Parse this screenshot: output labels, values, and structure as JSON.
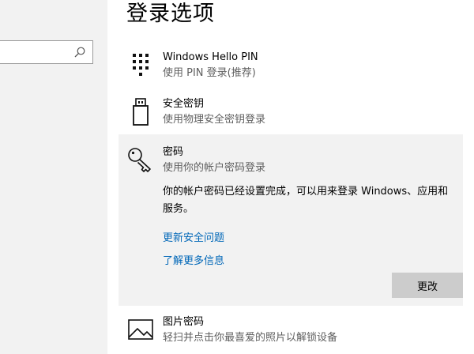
{
  "search": {
    "placeholder": "",
    "value": ""
  },
  "title": "登录选项",
  "options": [
    {
      "name": "Windows Hello PIN",
      "desc": "使用 PIN 登录(推荐)",
      "icon": "pin-keypad-icon"
    },
    {
      "name": "安全密钥",
      "desc": "使用物理安全密钥登录",
      "icon": "usb-key-icon"
    },
    {
      "name": "密码",
      "desc": "使用你的帐户密码登录",
      "icon": "key-icon",
      "body": "你的帐户密码已经设置完成，可以用来登录 Windows、应用和服务。",
      "links": [
        "更新安全问题",
        "了解更多信息"
      ],
      "button": "更改"
    },
    {
      "name": "图片密码",
      "desc": "轻扫并点击你最喜爱的照片以解锁设备",
      "icon": "picture-icon"
    }
  ],
  "colors": {
    "link": "#0067b8",
    "expanded_bg": "#f2f2f2",
    "button_bg": "#cccccc"
  }
}
